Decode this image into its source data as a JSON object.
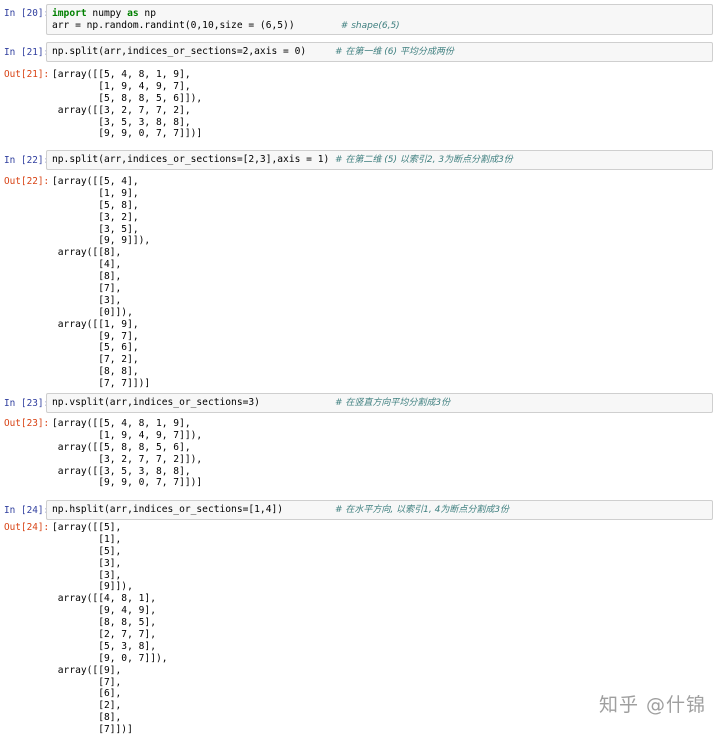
{
  "cells": [
    {
      "in_prompt": "In [20]:",
      "code": [
        {
          "text": "import numpy as np",
          "comment": ""
        },
        {
          "text": "arr = np.random.randint(0,10,size = (6,5))        ",
          "comment": "# shape(6,5)"
        }
      ]
    },
    {
      "in_prompt": "In [21]:",
      "code": [
        {
          "text": "np.split(arr,indices_or_sections=2,axis = 0)     ",
          "comment": "# 在第一维 (6) 平均分成两份"
        }
      ],
      "out_prompt": "Out[21]:",
      "output": [
        "[array([[5, 4, 8, 1, 9],",
        "        [1, 9, 4, 9, 7],",
        "        [5, 8, 8, 5, 6]]),",
        " array([[3, 2, 7, 7, 2],",
        "        [3, 5, 3, 8, 8],",
        "        [9, 9, 0, 7, 7]])]"
      ]
    },
    {
      "in_prompt": "In [22]:",
      "code": [
        {
          "text": "np.split(arr,indices_or_sections=[2,3],axis = 1) ",
          "comment": "# 在第二维 (5) 以索引2, 3为断点分割成3份"
        }
      ],
      "out_prompt": "Out[22]:",
      "output": [
        "[array([[5, 4],",
        "        [1, 9],",
        "        [5, 8],",
        "        [3, 2],",
        "        [3, 5],",
        "        [9, 9]]),",
        " array([[8],",
        "        [4],",
        "        [8],",
        "        [7],",
        "        [3],",
        "        [0]]),",
        " array([[1, 9],",
        "        [9, 7],",
        "        [5, 6],",
        "        [7, 2],",
        "        [8, 8],",
        "        [7, 7]])]"
      ]
    },
    {
      "in_prompt": "In [23]:",
      "code": [
        {
          "text": "np.vsplit(arr,indices_or_sections=3)             ",
          "comment": "# 在竖直方向平均分割成3份"
        }
      ],
      "out_prompt": "Out[23]:",
      "output": [
        "[array([[5, 4, 8, 1, 9],",
        "        [1, 9, 4, 9, 7]]),",
        " array([[5, 8, 8, 5, 6],",
        "        [3, 2, 7, 7, 2]]),",
        " array([[3, 5, 3, 8, 8],",
        "        [9, 9, 0, 7, 7]])]"
      ]
    },
    {
      "in_prompt": "In [24]:",
      "code": [
        {
          "text": "np.hsplit(arr,indices_or_sections=[1,4])         ",
          "comment": "# 在水平方向, 以索引1, 4为断点分割成3份"
        }
      ],
      "out_prompt": "Out[24]:",
      "output": [
        "[array([[5],",
        "        [1],",
        "        [5],",
        "        [3],",
        "        [3],",
        "        [9]]),",
        " array([[4, 8, 1],",
        "        [9, 4, 9],",
        "        [8, 8, 5],",
        "        [2, 7, 7],",
        "        [5, 3, 8],",
        "        [9, 0, 7]]),",
        " array([[9],",
        "        [7],",
        "        [6],",
        "        [2],",
        "        [8],",
        "        [7]])]"
      ]
    }
  ],
  "watermark": "知乎 @什锦"
}
